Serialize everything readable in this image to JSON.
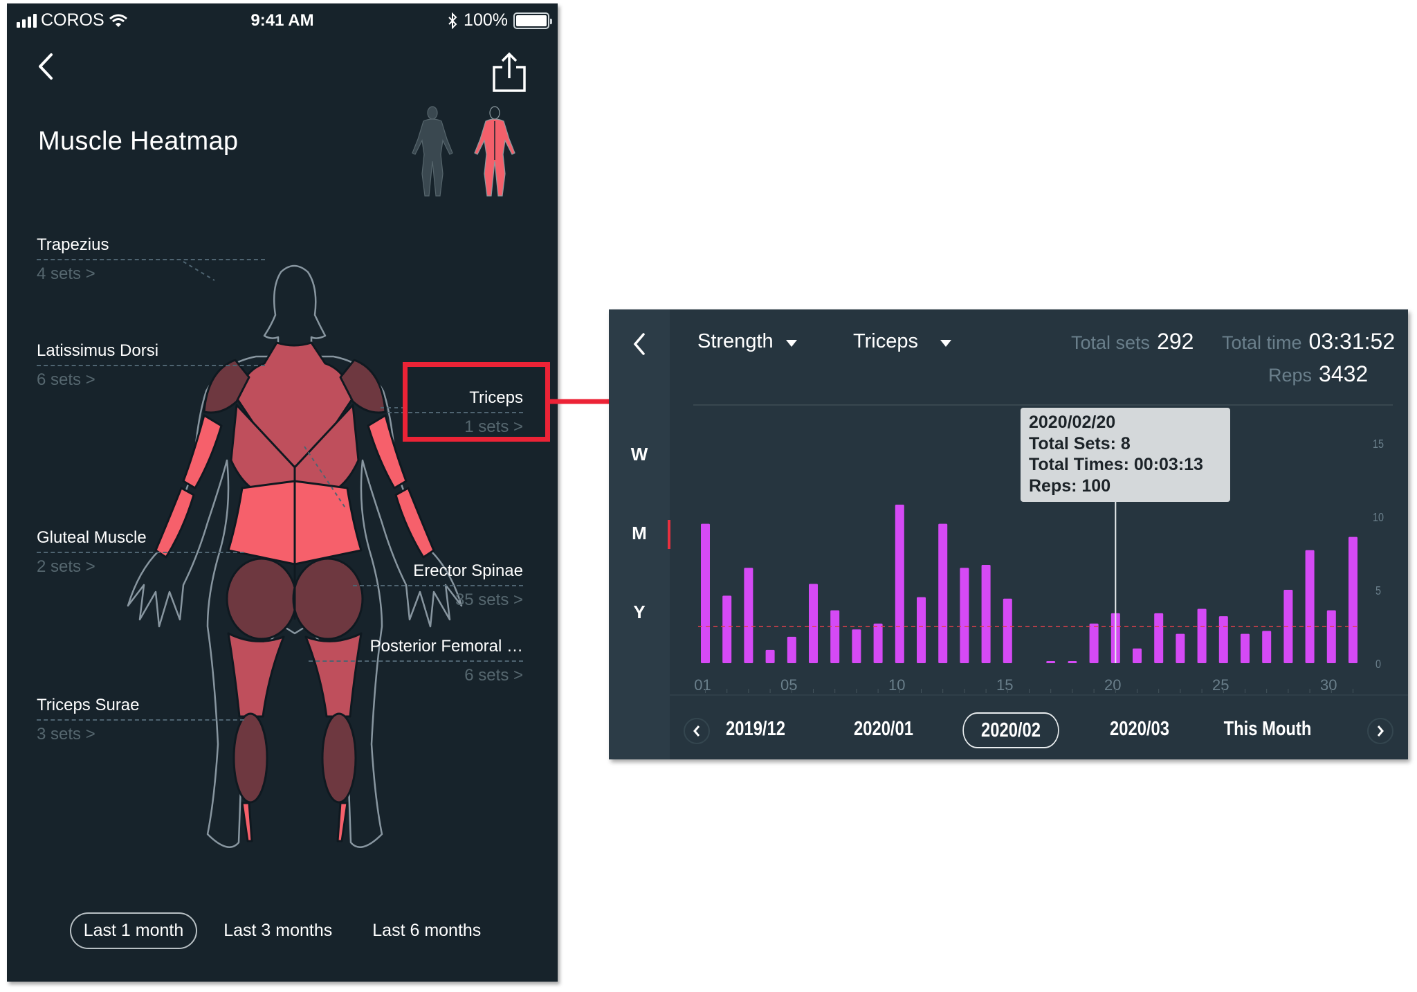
{
  "status_bar": {
    "carrier": "COROS",
    "time": "9:41 AM",
    "battery_percent": "100%",
    "icons": [
      "signal-icon",
      "wifi-icon",
      "bluetooth-icon",
      "battery-icon"
    ]
  },
  "heatmap": {
    "title": "Muscle Heatmap",
    "back_icon": "chevron-left-icon",
    "share_icon": "share-icon",
    "view_toggles": [
      "front-view",
      "back-view"
    ],
    "active_view": "back-view",
    "muscles": [
      {
        "name": "Trapezius",
        "sets": "4 sets >"
      },
      {
        "name": "Latissimus Dorsi",
        "sets": "6 sets >"
      },
      {
        "name": "Gluteal Muscle",
        "sets": "2 sets >"
      },
      {
        "name": "Triceps Surae",
        "sets": "3 sets >"
      },
      {
        "name": "Triceps",
        "sets": "1 sets >"
      },
      {
        "name": "Erector Spinae",
        "sets": "35 sets >"
      },
      {
        "name": "Posterior Femoral …",
        "sets": "6 sets >"
      }
    ],
    "ranges": [
      "Last 1 month",
      "Last 3 months",
      "Last 6 months"
    ],
    "active_range": "Last 1 month"
  },
  "colors": {
    "highlight": "#ec2336",
    "bar": "#d54af5",
    "average_line": "#e0404a",
    "muscle_high": "#f6606b",
    "muscle_mid": "#bf4f5c",
    "muscle_low": "#6e3840"
  },
  "detail": {
    "periods": [
      "W",
      "M",
      "Y"
    ],
    "active_period": "M",
    "filter_type": "Strength",
    "filter_muscle": "Triceps",
    "total_sets_label": "Total sets",
    "total_sets": "292",
    "total_time_label": "Total time",
    "total_time": "03:31:52",
    "reps_label": "Reps",
    "reps": "3432",
    "tooltip": {
      "date": "2020/02/20",
      "sets": "Total Sets: 8",
      "times": "Total Times: 00:03:13",
      "reps": "Reps: 100"
    },
    "months": [
      "2019/12",
      "2020/01",
      "2020/02",
      "2020/03",
      "This Mouth"
    ],
    "active_month": "2020/02"
  },
  "chart_data": {
    "type": "bar",
    "title": "",
    "xlabel": "",
    "ylabel": "",
    "x": [
      1,
      2,
      3,
      4,
      5,
      6,
      7,
      8,
      9,
      10,
      11,
      12,
      13,
      14,
      15,
      16,
      17,
      18,
      19,
      20,
      21,
      22,
      23,
      24,
      25,
      26,
      27,
      28,
      29,
      30,
      31
    ],
    "x_tick_labels": [
      "01",
      "05",
      "10",
      "15",
      "20",
      "25",
      "30"
    ],
    "x_tick_days": [
      1,
      5,
      10,
      15,
      20,
      25,
      30
    ],
    "values": [
      9.5,
      4.6,
      6.5,
      0.9,
      1.8,
      5.4,
      3.6,
      2.3,
      2.7,
      10.8,
      4.5,
      9.5,
      6.5,
      6.7,
      4.4,
      0,
      0.1,
      0.1,
      2.7,
      3.4,
      1.0,
      3.4,
      2.0,
      3.7,
      3.2,
      2.0,
      2.2,
      5.0,
      7.7,
      3.6,
      8.6
    ],
    "average_line": 2.5,
    "y_ticks": [
      0,
      5,
      10,
      15
    ],
    "ylim": [
      0,
      15
    ],
    "y_axis_side": "right",
    "selected_day": 20,
    "grid": false
  }
}
